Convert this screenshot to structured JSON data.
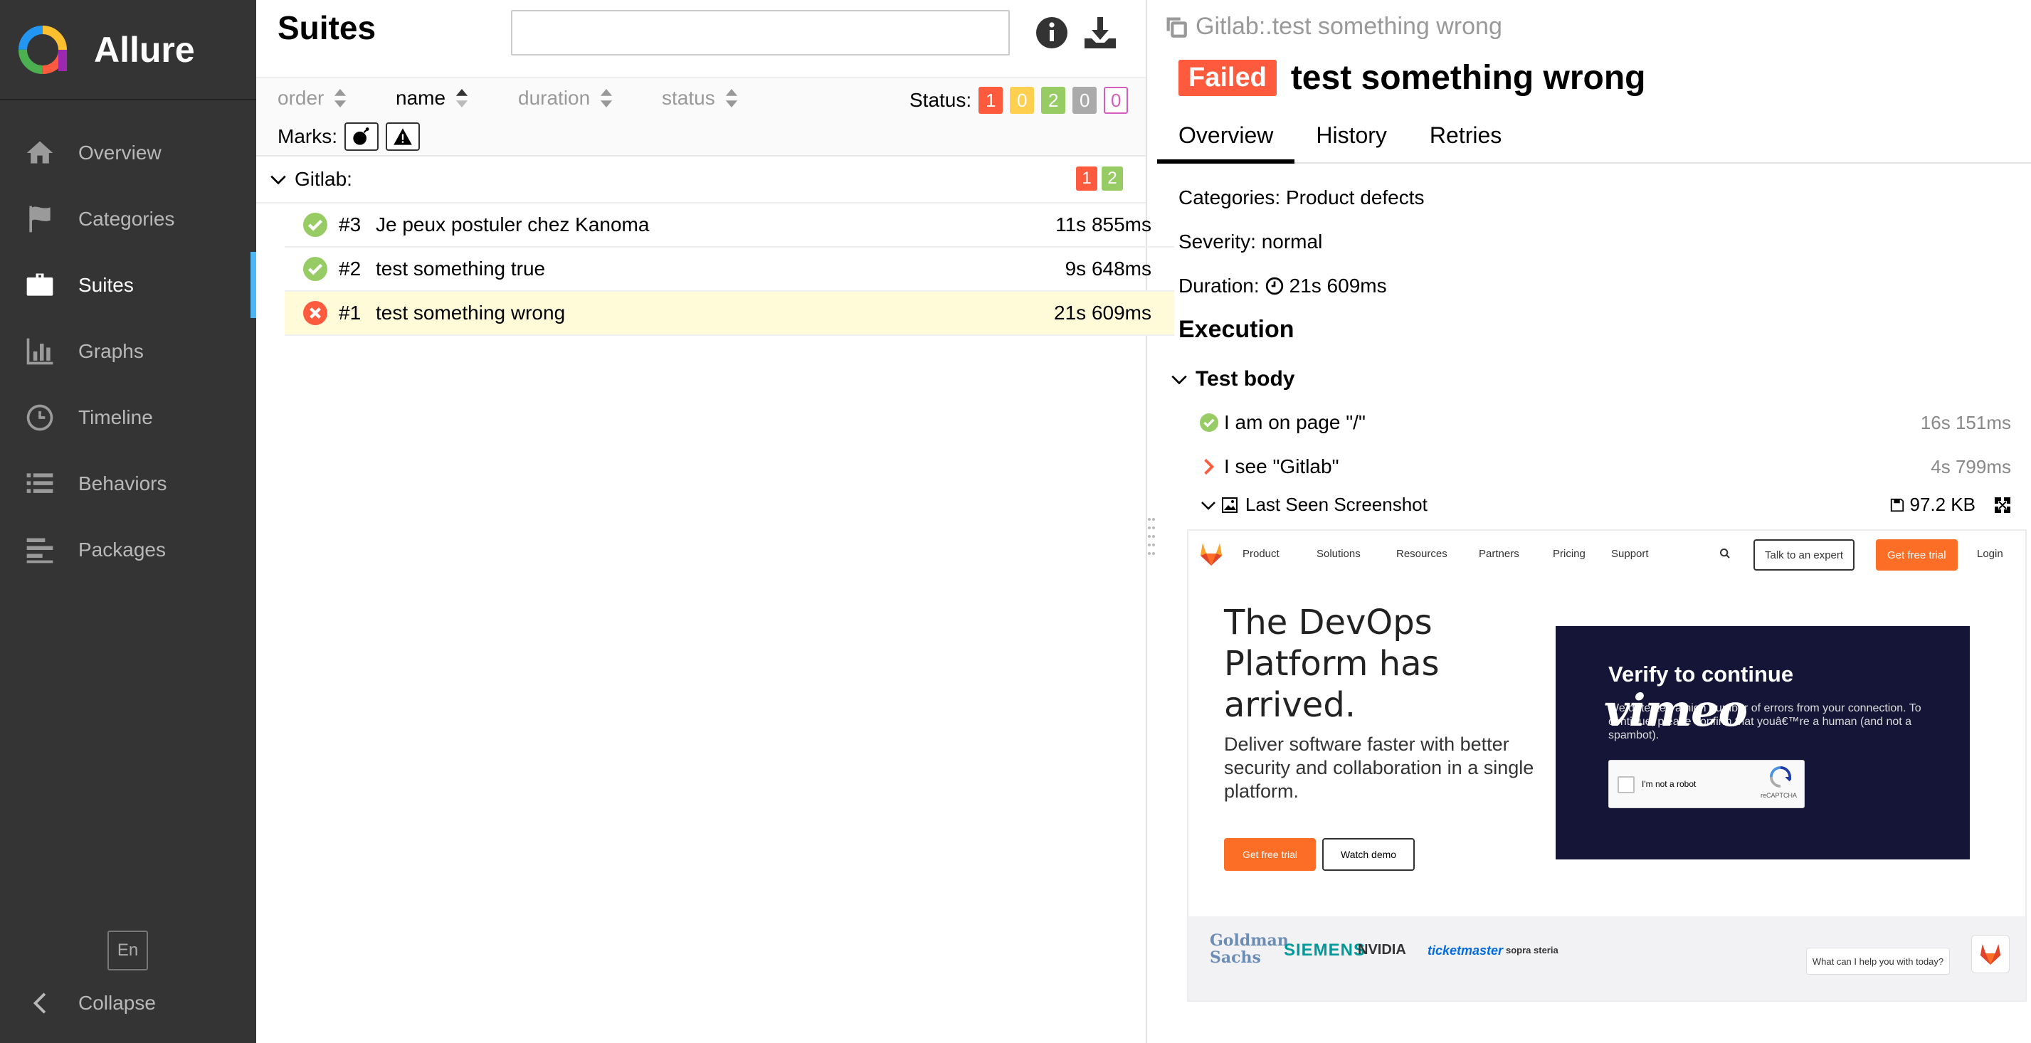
{
  "app": {
    "name": "Allure"
  },
  "sidebar": {
    "items": [
      {
        "label": "Overview",
        "icon": "home-icon"
      },
      {
        "label": "Categories",
        "icon": "flag-icon"
      },
      {
        "label": "Suites",
        "icon": "briefcase-icon",
        "active": true
      },
      {
        "label": "Graphs",
        "icon": "bar-chart-icon"
      },
      {
        "label": "Timeline",
        "icon": "clock-icon"
      },
      {
        "label": "Behaviors",
        "icon": "list-icon"
      },
      {
        "label": "Packages",
        "icon": "align-left-icon"
      }
    ],
    "language": "En",
    "collapse_label": "Collapse"
  },
  "suites": {
    "title": "Suites",
    "search": {
      "value": "",
      "placeholder": ""
    },
    "sort": {
      "order": "order",
      "name": "name",
      "duration": "duration",
      "status": "status"
    },
    "status_label": "Status:",
    "status_counts": {
      "failed": "1",
      "broken": "0",
      "passed": "2",
      "skipped": "0",
      "unknown": "0"
    },
    "marks_label": "Marks:",
    "group": {
      "name": "Gitlab:",
      "failed": "1",
      "passed": "2"
    },
    "tests": [
      {
        "num": "#3",
        "name": "Je peux postuler chez Kanoma",
        "duration": "11s 855ms",
        "status": "passed"
      },
      {
        "num": "#2",
        "name": "test something true",
        "duration": "9s 648ms",
        "status": "passed"
      },
      {
        "num": "#1",
        "name": "test something wrong",
        "duration": "21s 609ms",
        "status": "failed"
      }
    ]
  },
  "detail": {
    "breadcrumb": "Gitlab:.test something wrong",
    "status": "Failed",
    "title": "test something wrong",
    "tabs": [
      "Overview",
      "History",
      "Retries"
    ],
    "categories": "Categories: Product defects",
    "severity": "Severity: normal",
    "duration_label": "Duration:",
    "duration": "21s 609ms",
    "execution_title": "Execution",
    "test_body": "Test body",
    "steps": [
      {
        "name": "I am on page \"/\"",
        "duration": "16s 151ms",
        "status": "passed"
      },
      {
        "name": "I see \"Gitlab\"",
        "duration": "4s 799ms",
        "status": "failed"
      }
    ],
    "attachment": {
      "name": "Last Seen Screenshot",
      "size": "97.2 KB"
    }
  },
  "screenshot": {
    "nav": [
      "Product",
      "Solutions",
      "Resources",
      "Partners",
      "Pricing",
      "Support"
    ],
    "talk_button": "Talk to an expert",
    "free_trial_button": "Get free trial",
    "login": "Login",
    "hero": "The DevOps Platform has arrived.",
    "sub": "Deliver software faster with better security and collaboration in a single platform.",
    "cta_trial": "Get free trial",
    "cta_demo": "Watch demo",
    "verify_title": "Verify to continue",
    "verify_text": "We detected a high number of errors from your connection. To continue, please confirm that youâ€™re a human (and not a spambot).",
    "vimeo_logo": "vimeo",
    "captcha_label": "I'm not a robot",
    "captcha_brand": "reCAPTCHA",
    "logos": [
      "Goldman Sachs",
      "SIEMENS",
      "NVIDIA",
      "ticketmaster",
      "sopra steria"
    ],
    "chat_text": "What can I help you with today?"
  },
  "colors": {
    "failed": "#fd5a3e",
    "passed": "#97cc64",
    "broken": "#ffd050",
    "skipped": "#aaaaaa",
    "unknown": "#d35ebe",
    "accent": "#4db6f5",
    "sidebar": "#343434"
  }
}
